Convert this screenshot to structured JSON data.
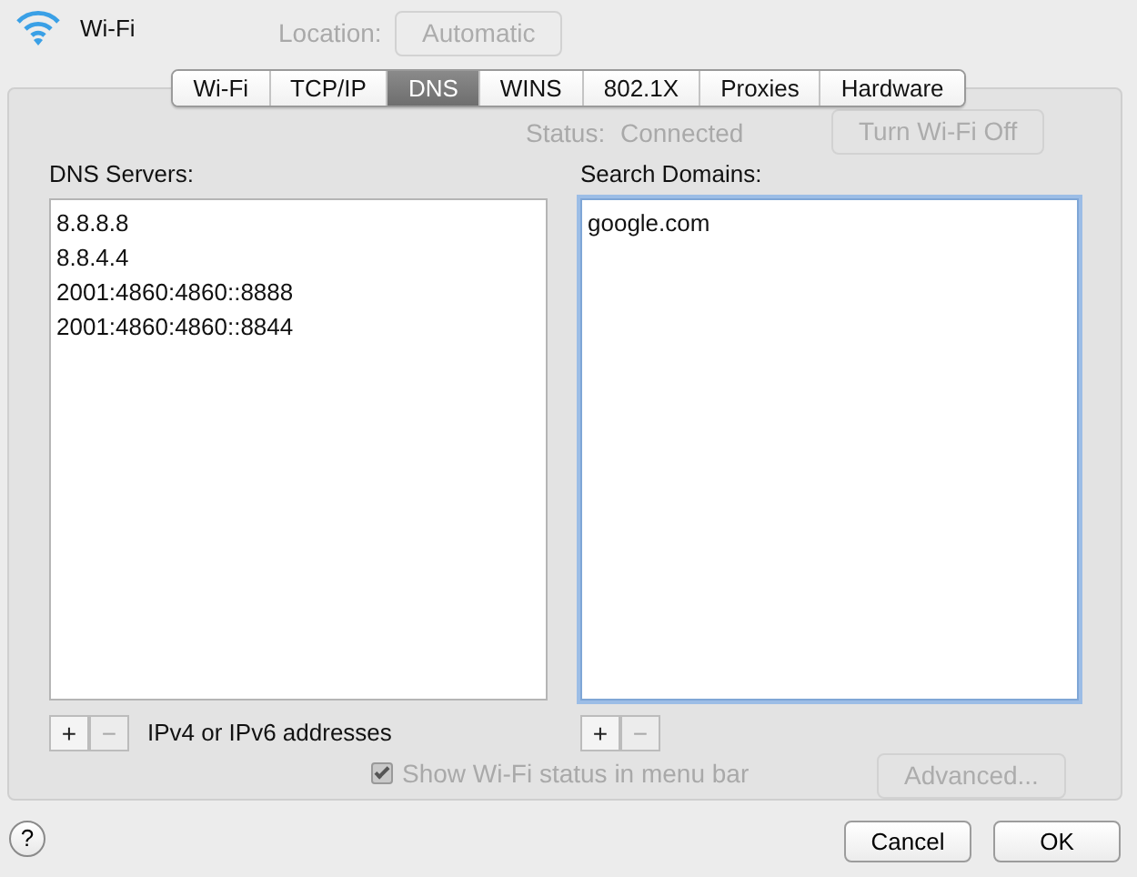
{
  "window": {
    "title": "Wi-Fi"
  },
  "background": {
    "location_label": "Location:",
    "location_value": "Automatic",
    "status_label": "Status:",
    "status_value": "Connected",
    "turn_off_button": "Turn Wi-Fi Off",
    "show_status": "Show Wi-Fi status in menu bar",
    "show_status_checked": true,
    "advanced_button": "Advanced..."
  },
  "tabs": [
    {
      "label": "Wi-Fi",
      "selected": false
    },
    {
      "label": "TCP/IP",
      "selected": false
    },
    {
      "label": "DNS",
      "selected": true
    },
    {
      "label": "WINS",
      "selected": false
    },
    {
      "label": "802.1X",
      "selected": false
    },
    {
      "label": "Proxies",
      "selected": false
    },
    {
      "label": "Hardware",
      "selected": false
    }
  ],
  "dns_servers": {
    "label": "DNS Servers:",
    "items": [
      "8.8.8.8",
      "8.8.4.4",
      "2001:4860:4860::8888",
      "2001:4860:4860::8844"
    ],
    "add": "+",
    "remove": "−",
    "hint": "IPv4 or IPv6 addresses",
    "focused": false
  },
  "search_domains": {
    "label": "Search Domains:",
    "items": [
      "google.com"
    ],
    "add": "+",
    "remove": "−",
    "focused": true
  },
  "help_button": "?",
  "buttons": [
    "Cancel",
    "OK"
  ]
}
